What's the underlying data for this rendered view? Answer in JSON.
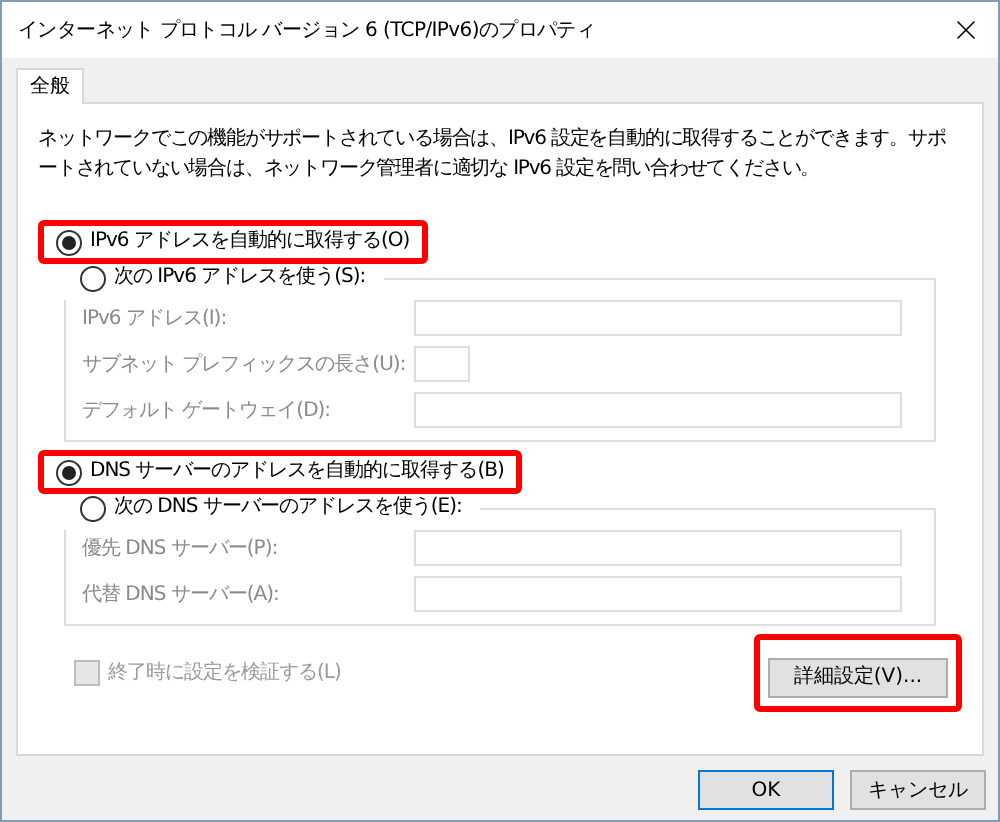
{
  "window": {
    "title": "インターネット プロトコル バージョン 6 (TCP/IPv6)のプロパティ"
  },
  "tabs": [
    {
      "label": "全般",
      "selected": true
    }
  ],
  "description": "ネットワークでこの機能がサポートされている場合は、IPv6 設定を自動的に取得することができます。サポートされていない場合は、ネットワーク管理者に適切な IPv6 設定を問い合わせてください。",
  "ip": {
    "auto": {
      "label": "IPv6 アドレスを自動的に取得する(O)",
      "selected": true,
      "highlighted": true
    },
    "manual": {
      "label": "次の IPv6 アドレスを使う(S):",
      "selected": false
    },
    "fields": [
      {
        "label": "IPv6 アドレス(I):",
        "kind": "wide",
        "disabled": true
      },
      {
        "label": "サブネット プレフィックスの長さ(U):",
        "kind": "short",
        "disabled": true
      },
      {
        "label": "デフォルト ゲートウェイ(D):",
        "kind": "wide",
        "disabled": true
      }
    ]
  },
  "dns": {
    "auto": {
      "label": "DNS サーバーのアドレスを自動的に取得する(B)",
      "selected": true,
      "highlighted": true
    },
    "manual": {
      "label": "次の DNS サーバーのアドレスを使う(E):",
      "selected": false
    },
    "fields": [
      {
        "label": "優先 DNS サーバー(P):",
        "kind": "wide",
        "disabled": true
      },
      {
        "label": "代替 DNS サーバー(A):",
        "kind": "wide",
        "disabled": true
      }
    ]
  },
  "validate": {
    "label": "終了時に設定を検証する(L)",
    "checked": false,
    "disabled": true
  },
  "advanced": {
    "label": "詳細設定(V)...",
    "highlighted": true
  },
  "buttons": [
    {
      "label": "OK",
      "default": true
    },
    {
      "label": "キャンセル",
      "default": false
    }
  ]
}
